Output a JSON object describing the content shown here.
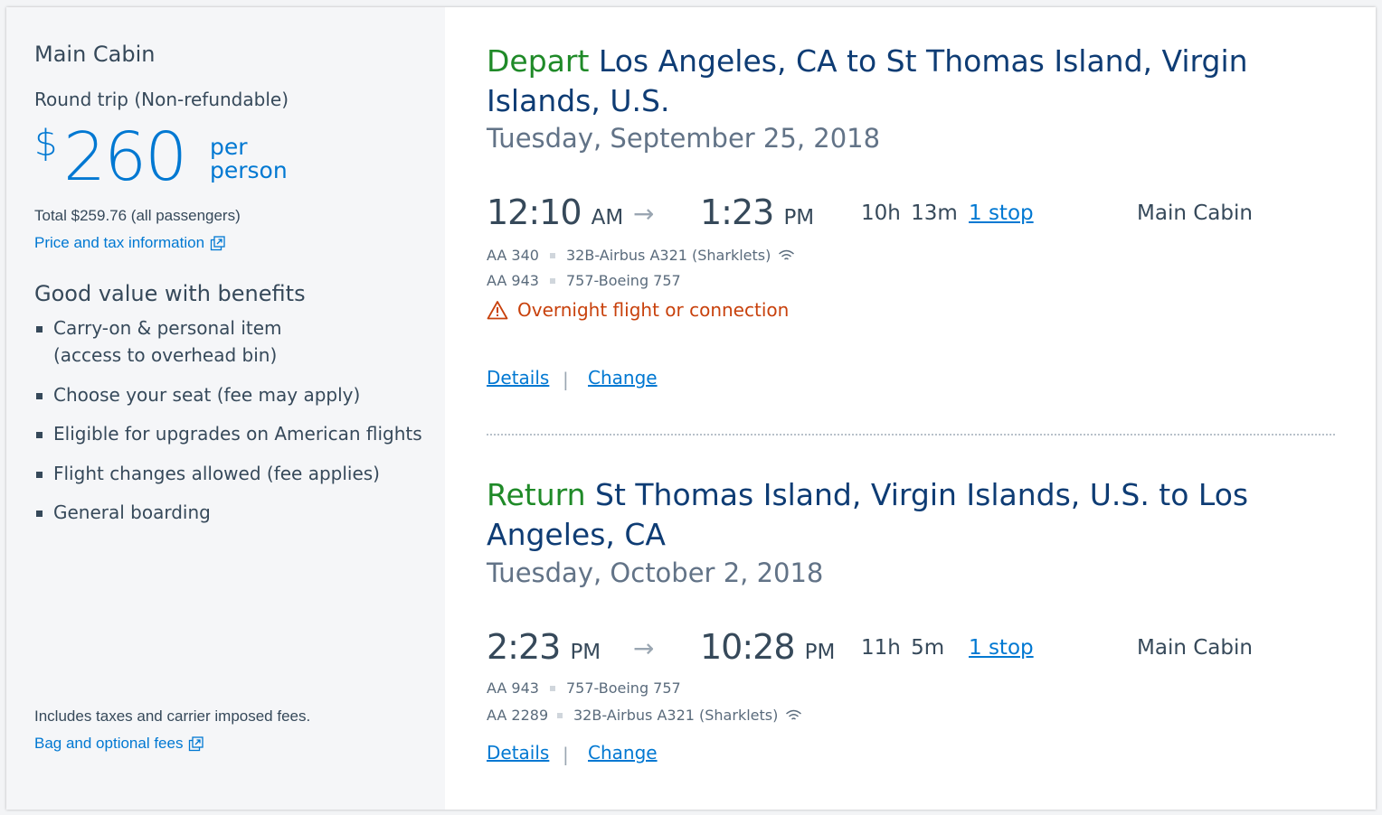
{
  "sidebar": {
    "cabin_title": "Main Cabin",
    "trip_type": "Round trip (Non-refundable)",
    "price_currency": "$",
    "price_amount": "260",
    "price_per_line1": "per",
    "price_per_line2": "person",
    "total": "Total $259.76 (all passengers)",
    "price_tax_link": "Price and tax information",
    "benefits_title": "Good value with benefits",
    "benefits": [
      {
        "line1": "Carry-on & personal item",
        "line2": "(access to overhead bin)"
      },
      {
        "line1": "Choose your seat (fee may apply)"
      },
      {
        "line1": "Eligible for upgrades on American flights"
      },
      {
        "line1": "Flight changes allowed (fee applies)"
      },
      {
        "line1": "General boarding"
      }
    ],
    "fees_note": "Includes taxes and carrier imposed fees.",
    "bag_link": "Bag and optional fees"
  },
  "depart": {
    "label": "Depart",
    "route": "Los Angeles, CA to St Thomas Island, Virgin Islands, U.S.",
    "date": "Tuesday, September 25, 2018",
    "depart_time": "12:10",
    "depart_ampm": "AM",
    "arrive_time": "1:23",
    "arrive_ampm": "PM",
    "duration": "10h 13m",
    "stops": "1 stop",
    "cabin": "Main Cabin",
    "flights": [
      {
        "number": "AA 340",
        "aircraft": "32B-Airbus A321 (Sharklets)",
        "wifi": true
      },
      {
        "number": "AA 943",
        "aircraft": "757-Boeing 757",
        "wifi": false
      }
    ],
    "warning": "Overnight flight or connection",
    "details": "Details",
    "change": "Change",
    "separator": "|"
  },
  "return": {
    "label": "Return",
    "route": "St Thomas Island, Virgin Islands, U.S. to Los Angeles, CA",
    "date": "Tuesday, October 2, 2018",
    "depart_time": "2:23",
    "depart_ampm": "PM",
    "arrive_time": "10:28",
    "arrive_ampm": "PM",
    "duration": "11h 5m",
    "stops": "1 stop",
    "cabin": "Main Cabin",
    "flights": [
      {
        "number": "AA 943",
        "aircraft": "757-Boeing 757",
        "wifi": false
      },
      {
        "number": "AA 2289",
        "aircraft": "32B-Airbus A321 (Sharklets)",
        "wifi": true
      }
    ],
    "details": "Details",
    "change": "Change",
    "separator": "|"
  },
  "icons": {
    "arrow": "arrow-right-icon",
    "external": "external-link-icon",
    "wifi": "wifi-icon",
    "warning": "warning-triangle-icon"
  },
  "colors": {
    "accent": "#0078d2",
    "depart_return_label": "#1f8a28",
    "route_title": "#0e3c74",
    "warning": "#c8410c"
  }
}
